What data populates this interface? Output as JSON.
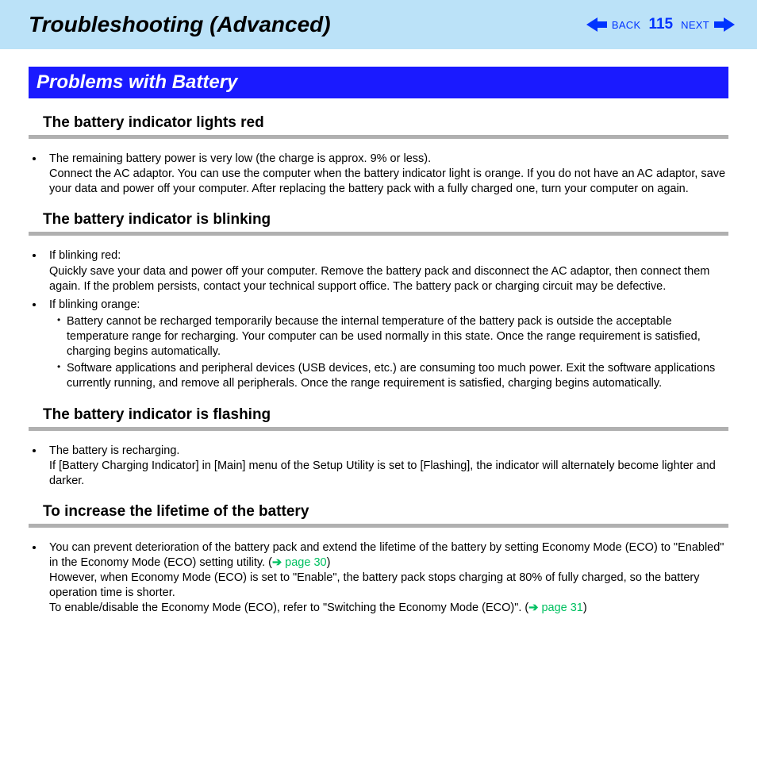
{
  "header": {
    "title": "Troubleshooting (Advanced)",
    "back_label": "BACK",
    "next_label": "NEXT",
    "page_number": "115"
  },
  "section_banner": "Problems with Battery",
  "sec1": {
    "heading": "The battery indicator lights red",
    "line1": "The remaining battery power is very low (the charge is approx. 9% or less).",
    "line2": "Connect the AC adaptor. You can use the computer when the battery indicator light is orange. If you do not have an AC adaptor, save your data and power off your computer. After replacing the battery pack with a fully charged one, turn your computer on again."
  },
  "sec2": {
    "heading": "The battery indicator is blinking",
    "red_label": "If blinking red:",
    "red_text": "Quickly save your data and power off your computer. Remove the battery pack and disconnect the AC adaptor, then connect them again. If the problem persists, contact your technical support office. The battery pack or charging circuit may be defective.",
    "orange_label": "If blinking orange:",
    "orange_sub1": "Battery cannot be recharged temporarily because the internal temperature of the battery pack is outside the acceptable temperature range for recharging. Your computer can be used normally in this state. Once the range requirement is satisfied, charging begins automatically.",
    "orange_sub2": "Software applications and peripheral devices (USB devices, etc.) are consuming too much power. Exit the software applications currently running, and remove all peripherals. Once the range requirement is satisfied, charging begins automatically."
  },
  "sec3": {
    "heading": "The battery indicator is flashing",
    "line1": "The battery is recharging.",
    "line2": "If [Battery Charging Indicator] in [Main] menu of the Setup Utility is set to [Flashing], the indicator will alternately become lighter and darker."
  },
  "sec4": {
    "heading": "To increase the lifetime of the battery",
    "line1a": "You can prevent deterioration of the battery pack and extend the lifetime of the battery by setting Economy Mode (ECO) to \"Enabled\" in the Economy Mode (ECO) setting utility. (",
    "link1": "page 30",
    "line1b": ")",
    "line2": "However, when Economy Mode (ECO) is set to \"Enable\", the battery pack stops charging at 80% of fully charged, so the battery operation time is shorter.",
    "line3a": "To enable/disable the Economy Mode (ECO), refer to \"Switching the Economy Mode (ECO)\". (",
    "link2": "page 31",
    "line3b": ")"
  }
}
